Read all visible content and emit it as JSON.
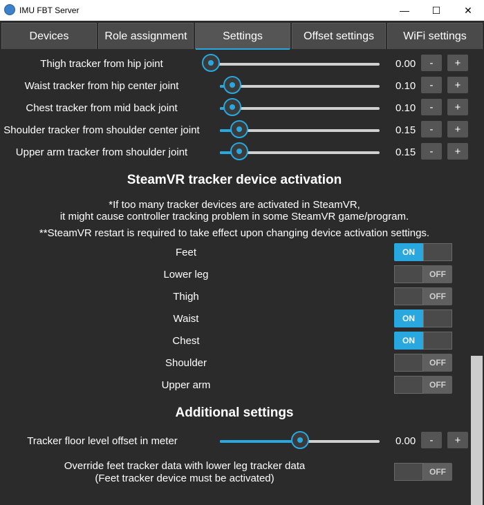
{
  "window": {
    "title": "IMU FBT Server",
    "minimize": "—",
    "maximize": "☐",
    "close": "✕"
  },
  "tabs": [
    {
      "label": "Devices",
      "active": false
    },
    {
      "label": "Role assignment",
      "active": false
    },
    {
      "label": "Settings",
      "active": true
    },
    {
      "label": "Offset settings",
      "active": false
    },
    {
      "label": "WiFi settings",
      "active": false
    }
  ],
  "sliders": [
    {
      "label": "Thigh tracker from hip joint",
      "value": "0.00",
      "fraction": 0.0
    },
    {
      "label": "Waist tracker from hip center joint",
      "value": "0.10",
      "fraction": 0.08
    },
    {
      "label": "Chest tracker from mid back joint",
      "value": "0.10",
      "fraction": 0.08
    },
    {
      "label": "Shoulder tracker from shoulder center joint",
      "value": "0.15",
      "fraction": 0.12
    },
    {
      "label": "Upper arm tracker from shoulder joint",
      "value": "0.15",
      "fraction": 0.12
    }
  ],
  "stepper": {
    "minus": "-",
    "plus": "+"
  },
  "activation": {
    "heading": "SteamVR tracker device activation",
    "note_line1": "*If too many tracker devices are activated in SteamVR,",
    "note_line2": "it might cause controller tracking problem in some SteamVR game/program.",
    "note_line3": "**SteamVR restart is required to take effect upon changing device activation settings.",
    "on_text": "ON",
    "off_text": "OFF",
    "toggles": [
      {
        "label": "Feet",
        "on": true
      },
      {
        "label": "Lower leg",
        "on": false
      },
      {
        "label": "Thigh",
        "on": false
      },
      {
        "label": "Waist",
        "on": true
      },
      {
        "label": "Chest",
        "on": true
      },
      {
        "label": "Shoulder",
        "on": false
      },
      {
        "label": "Upper arm",
        "on": false
      }
    ]
  },
  "additional": {
    "heading": "Additional settings",
    "floor_offset": {
      "label": "Tracker floor level offset in meter",
      "value": "0.00",
      "fraction": 0.5
    },
    "override_line1": "Override feet tracker data with lower leg tracker data",
    "override_line2": "(Feet tracker device must be activated)",
    "override_on": false
  },
  "colors": {
    "accent": "#29a8e0",
    "background": "#2b2b2b",
    "tab": "#4a4a4a"
  }
}
